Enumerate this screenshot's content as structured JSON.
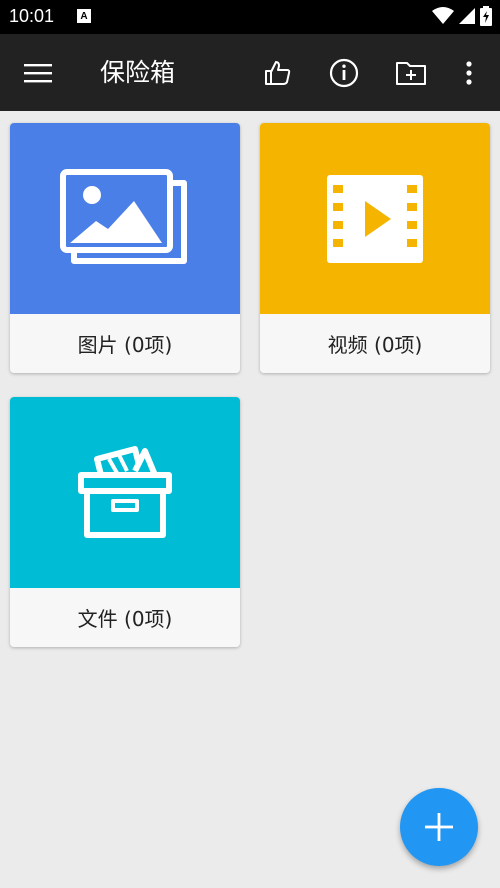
{
  "status_bar": {
    "time": "10:01",
    "notification_badge": "A",
    "icons": [
      "wifi-icon",
      "signal-icon",
      "battery-icon"
    ]
  },
  "app_bar": {
    "title": "保险箱",
    "actions": [
      "menu-icon",
      "thumbs-up-icon",
      "info-icon",
      "new-folder-icon",
      "more-vert-icon"
    ]
  },
  "vault": {
    "items": [
      {
        "label": "图片 (0项)",
        "icon": "images-icon",
        "color": "#4a7fe8"
      },
      {
        "label": "视频 (0项)",
        "icon": "video-film-icon",
        "color": "#f4b400"
      },
      {
        "label": "文件 (0项)",
        "icon": "archive-box-icon",
        "color": "#00bcd4"
      }
    ]
  },
  "fab": {
    "icon": "plus-icon",
    "color": "#2196f3"
  },
  "colors": {
    "app_bar": "#222222",
    "background": "#ebebeb"
  }
}
